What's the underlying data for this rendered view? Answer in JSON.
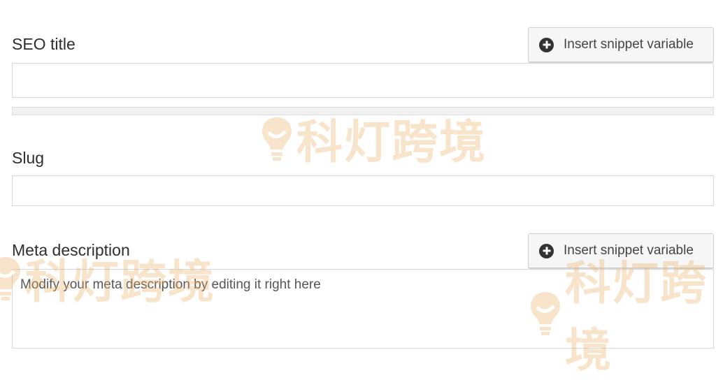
{
  "seo_title": {
    "label": "SEO title",
    "button_label": "Insert snippet variable",
    "value": "",
    "progress": 0
  },
  "slug": {
    "label": "Slug",
    "value": ""
  },
  "meta_description": {
    "label": "Meta description",
    "button_label": "Insert snippet variable",
    "placeholder": "Modify your meta description by editing it right here"
  },
  "watermark": {
    "text": "科灯跨境"
  },
  "colors": {
    "button_bg": "#f6f6f6",
    "icon_dark": "#333333",
    "border": "#d8d8d8",
    "watermark": "#ecb269"
  },
  "icons": {
    "insert_snippet": "plus-circle-icon"
  }
}
